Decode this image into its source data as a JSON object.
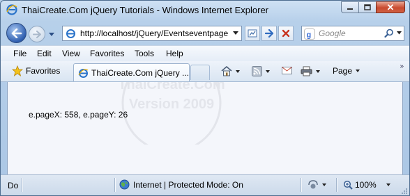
{
  "window": {
    "title": "ThaiCreate.Com jQuery Tutorials - Windows Internet Explorer",
    "close_glyph": "✕"
  },
  "navigation": {
    "address": "http://localhost/jQuery/Eventseventpage",
    "search_placeholder": "Google"
  },
  "menu": {
    "items": [
      "File",
      "Edit",
      "View",
      "Favorites",
      "Tools",
      "Help"
    ]
  },
  "favorites_bar": {
    "favorites_label": "Favorites",
    "tab_title": "ThaiCreate.Com jQuery ...",
    "page_label": "Page",
    "chevron": "»"
  },
  "content": {
    "text": "e.pageX: 558, e.pageY: 26",
    "watermark_line1": "ThaiCreate.Com",
    "watermark_line2": "Version 2009"
  },
  "status_bar": {
    "status_text": "Do",
    "zone_text": "Internet | Protected Mode: On",
    "zoom_level": "100%"
  },
  "colors": {
    "accent": "#1f5fb6",
    "close_red": "#c94a2f",
    "frame": "#b9d1ea"
  }
}
